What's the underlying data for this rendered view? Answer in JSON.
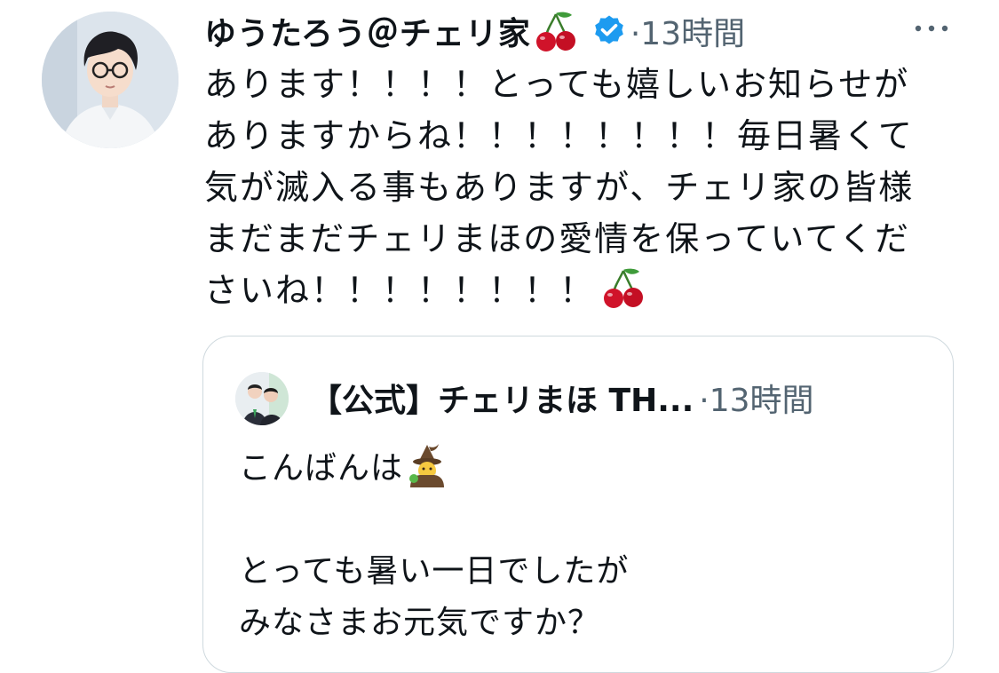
{
  "tweet": {
    "author": {
      "display_name": "ゆうたろう＠チェリ家",
      "name_emoji": "cherries-emoji",
      "verified": true
    },
    "meta": "·13時間",
    "more_icon": "more-horizontal-icon",
    "text_lines": [
      "あります！！！！とっても嬉しいお知らせが",
      "ありますからね！！！！！！！！毎日暑くて",
      "気が滅入る事もありますが、チェリ家の皆様",
      "まだまだチェリまほの愛情を保っていてくだ",
      "さいね！！！！！！！！"
    ],
    "trailing_emoji": "cherries-emoji"
  },
  "quote": {
    "author_name": "【公式】チェリまほ TH...",
    "meta": "·13時間",
    "text_line1": "こんばんは",
    "text_line1_emoji": "mage-emoji",
    "text_line2": "とっても暑い一日でしたが",
    "text_line3": "みなさまお元気ですか？"
  },
  "colors": {
    "text": "#0f1419",
    "secondary": "#536471",
    "verified": "#1d9bf0",
    "border": "#cfd9de",
    "cherry": "#d0132a"
  }
}
